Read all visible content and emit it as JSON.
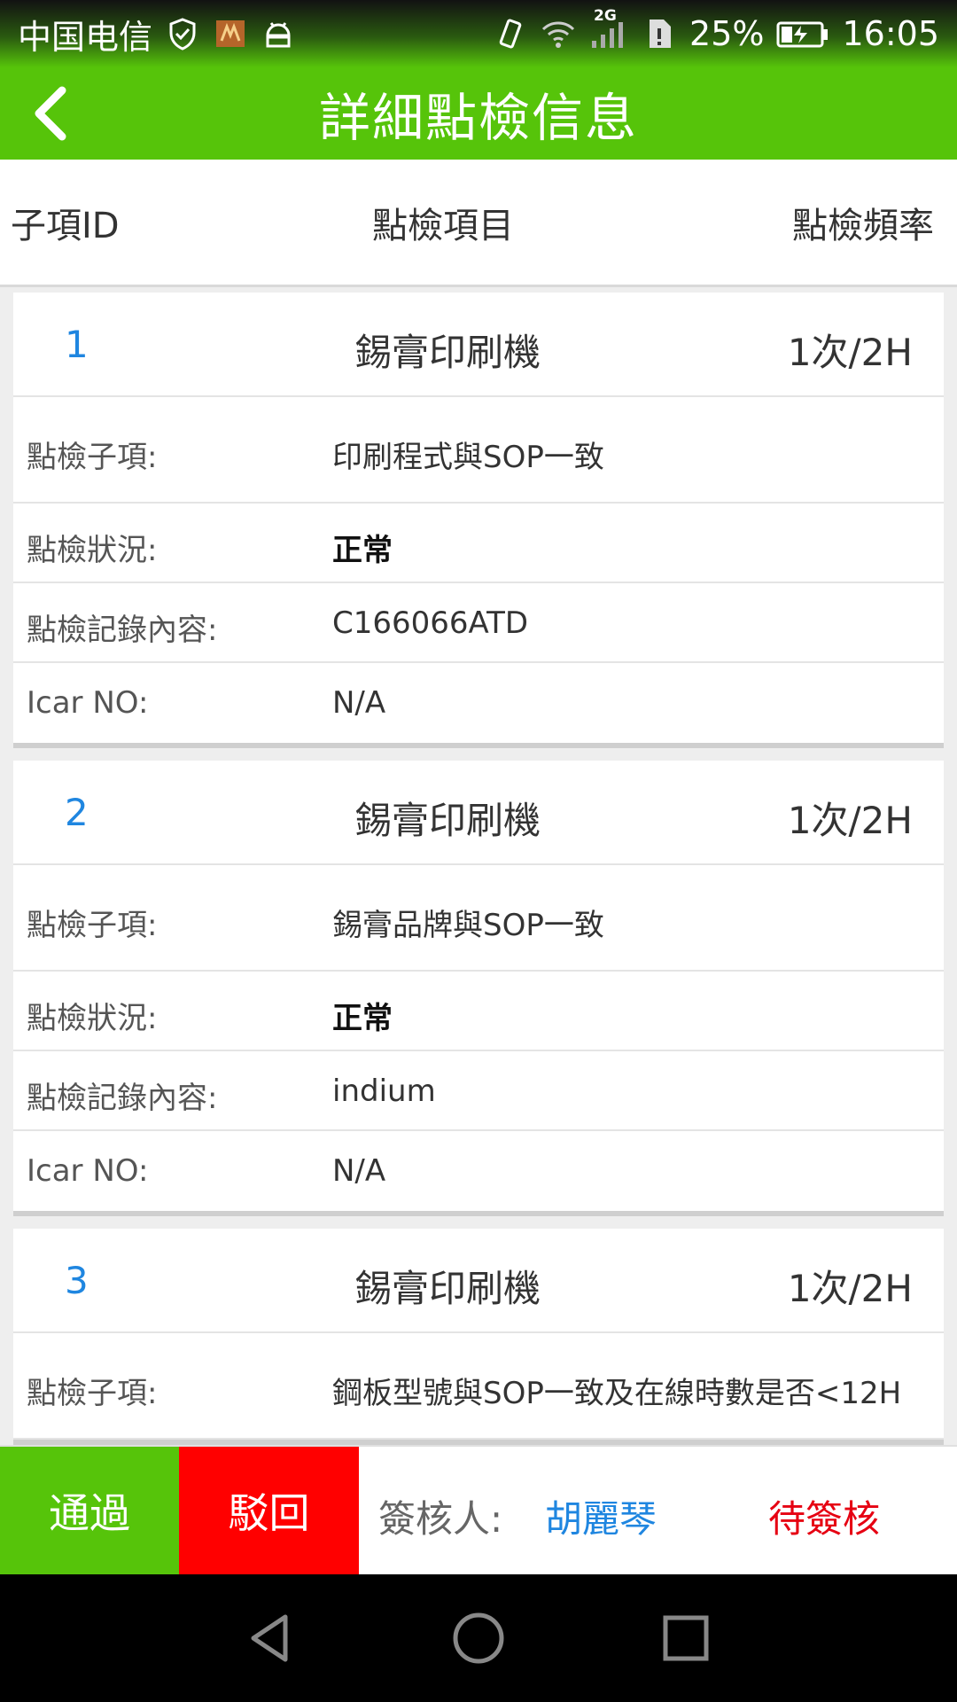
{
  "status_bar": {
    "carrier": "中国电信",
    "network_badge": "2G",
    "battery": "25%",
    "time": "16:05",
    "icons": [
      "shield-check-icon",
      "app-notification-icon",
      "android-icon",
      "vibrate-icon",
      "wifi-icon",
      "signal-icon",
      "sim-alert-icon",
      "battery-charging-icon"
    ]
  },
  "app_bar": {
    "title": "詳細點檢信息",
    "back_icon": "chevron-left-icon"
  },
  "columns": {
    "id": "子項ID",
    "item": "點檢項目",
    "frequency": "點檢頻率"
  },
  "records": [
    {
      "id": "1",
      "item": "錫膏印刷機",
      "frequency": "1次/2H",
      "sub_item_label": "點檢子項:",
      "sub_item": "印刷程式與SOP一致",
      "status_label": "點檢狀況:",
      "status": "正常",
      "content_label": "點檢記錄內容:",
      "content": "C166066ATD",
      "icar_label": "Icar NO:",
      "icar": "N/A"
    },
    {
      "id": "2",
      "item": "錫膏印刷機",
      "frequency": "1次/2H",
      "sub_item_label": "點檢子項:",
      "sub_item": "錫膏品牌與SOP一致",
      "status_label": "點檢狀況:",
      "status": "正常",
      "content_label": "點檢記錄內容:",
      "content": "indium",
      "icar_label": "Icar NO:",
      "icar": "N/A"
    },
    {
      "id": "3",
      "item": "錫膏印刷機",
      "frequency": "1次/2H",
      "sub_item_label": "點檢子項:",
      "sub_item": "鋼板型號與SOP一致及在線時數是否<12H"
    }
  ],
  "actions": {
    "pass": "通過",
    "reject": "駁回",
    "approver_label": "簽核人:",
    "approver_name": "胡麗琴",
    "approval_status": "待簽核"
  },
  "colors": {
    "accent_green": "#56c40a",
    "reject_red": "#ff0000",
    "link_blue": "#1f86e0",
    "pending_red": "#e60012"
  },
  "nav_bar": {
    "icons": [
      "back-triangle-icon",
      "home-circle-icon",
      "recents-square-icon"
    ]
  }
}
